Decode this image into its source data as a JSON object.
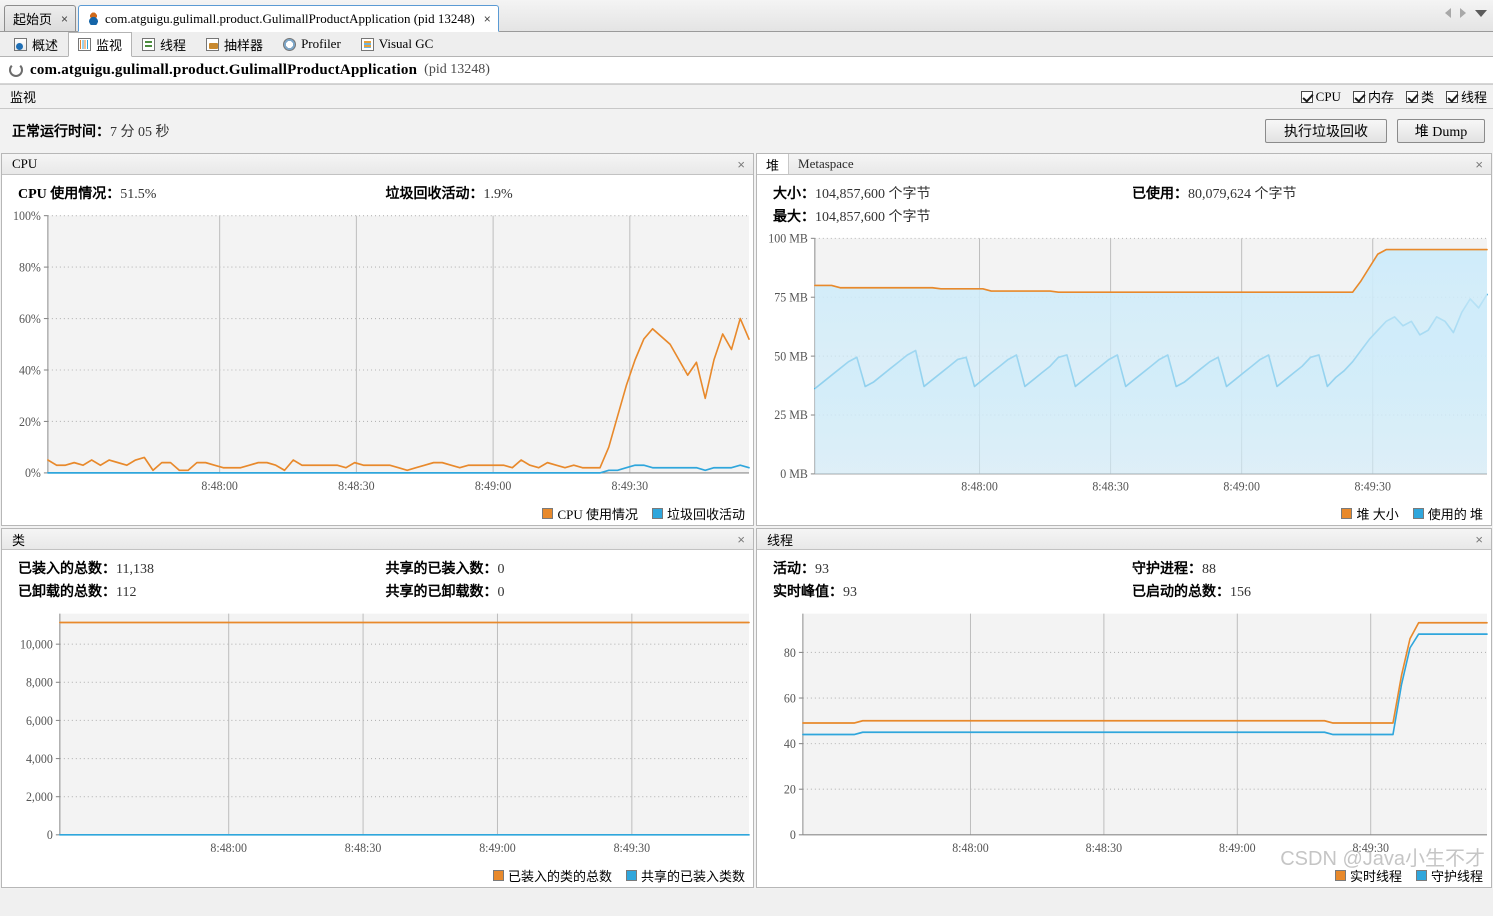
{
  "window": {
    "tabs": [
      {
        "label": "起始页",
        "icon": "none",
        "active": false,
        "closable": true
      },
      {
        "label": "com.atguigu.gulimall.product.GulimallProductApplication (pid 13248)",
        "icon": "java-icon",
        "active": true,
        "closable": true
      }
    ],
    "nav": {
      "prev": "left-arrow-icon",
      "next": "right-arrow-icon",
      "list": "chevron-down-icon"
    }
  },
  "subtabs": [
    {
      "label": "概述",
      "icon": "overview-icon",
      "active": false
    },
    {
      "label": "监视",
      "icon": "monitor-icon",
      "active": true
    },
    {
      "label": "线程",
      "icon": "threads-icon",
      "active": false
    },
    {
      "label": "抽样器",
      "icon": "sampler-icon",
      "active": false
    },
    {
      "label": "Profiler",
      "icon": "profiler-icon",
      "active": false
    },
    {
      "label": "Visual GC",
      "icon": "visualgc-icon",
      "active": false
    }
  ],
  "app_header": {
    "name": "com.atguigu.gulimall.product.GulimallProductApplication",
    "pid": "(pid 13248)"
  },
  "monitor_bar": {
    "title": "监视",
    "checkboxes": [
      {
        "label": "CPU",
        "checked": true
      },
      {
        "label": "内存",
        "checked": true
      },
      {
        "label": "类",
        "checked": true
      },
      {
        "label": "线程",
        "checked": true
      }
    ]
  },
  "uptime": {
    "label": "正常运行时间：",
    "value": "7 分 05 秒"
  },
  "actions": {
    "gc_label": "执行垃圾回收",
    "heapdump_label": "堆 Dump"
  },
  "panels": {
    "cpu": {
      "tab_title": "CPU",
      "close": "×",
      "stats": [
        {
          "label": "CPU 使用情况：",
          "value": "51.5%"
        },
        {
          "label": "垃圾回收活动：",
          "value": "1.9%"
        }
      ],
      "legend": [
        {
          "label": "CPU 使用情况",
          "color": "#e8892b"
        },
        {
          "label": "垃圾回收活动",
          "color": "#2fa6dc"
        }
      ]
    },
    "heap": {
      "tab_title": "堆",
      "tab_secondary": "Metaspace",
      "close": "×",
      "stats": [
        {
          "label": "大小：",
          "value": "104,857,600 个字节"
        },
        {
          "label": "已使用：",
          "value": "80,079,624 个字节"
        },
        {
          "label": "最大：",
          "value": "104,857,600 个字节"
        }
      ],
      "legend": [
        {
          "label": "堆 大小",
          "color": "#e8892b"
        },
        {
          "label": "使用的 堆",
          "color": "#2fa6dc"
        }
      ]
    },
    "classes": {
      "tab_title": "类",
      "close": "×",
      "stats": [
        {
          "label": "已装入的总数：",
          "value": "11,138"
        },
        {
          "label": "共享的已装入数：",
          "value": "0"
        },
        {
          "label": "已卸载的总数：",
          "value": "112"
        },
        {
          "label": "共享的已卸载数：",
          "value": "0"
        }
      ],
      "legend": [
        {
          "label": "已装入的类的总数",
          "color": "#e8892b"
        },
        {
          "label": "共享的已装入类数",
          "color": "#2fa6dc"
        }
      ]
    },
    "threads": {
      "tab_title": "线程",
      "close": "×",
      "stats": [
        {
          "label": "活动：",
          "value": "93"
        },
        {
          "label": "守护进程：",
          "value": "88"
        },
        {
          "label": "实时峰值：",
          "value": "93"
        },
        {
          "label": "已启动的总数：",
          "value": "156"
        }
      ],
      "legend": [
        {
          "label": "实时线程",
          "color": "#e8892b"
        },
        {
          "label": "守护线程",
          "color": "#2fa6dc"
        }
      ]
    }
  },
  "watermark": "CSDN @Java小生不才",
  "colors": {
    "orange": "#e8892b",
    "blue": "#2fa6dc",
    "orange_fill": "#f6d2a4",
    "blue_fill": "#cfecfa",
    "plot_bg": "#f3f3f3",
    "grid": "#c9c9c9"
  },
  "chart_data": [
    {
      "type": "line",
      "id": "cpu-chart",
      "title": "CPU",
      "xlabel": "",
      "ylabel": "",
      "ylim": [
        0,
        100
      ],
      "yticks": [
        "0%",
        "20%",
        "40%",
        "60%",
        "80%",
        "100%"
      ],
      "xticks": [
        "8:48:00",
        "8:48:30",
        "8:49:00",
        "8:49:30"
      ],
      "xtick_positions": [
        0.245,
        0.44,
        0.635,
        0.83
      ],
      "grid": true,
      "legend_position": "bottom-right",
      "series": [
        {
          "name": "CPU 使用情况",
          "color": "#e8892b",
          "values": [
            5,
            3,
            3,
            4,
            3,
            5,
            3,
            5,
            4,
            3,
            5,
            6,
            1,
            4,
            4,
            1,
            1,
            4,
            4,
            3,
            2,
            2,
            2,
            3,
            4,
            4,
            3,
            1,
            5,
            3,
            3,
            3,
            3,
            3,
            2,
            4,
            3,
            3,
            3,
            3,
            2,
            1,
            2,
            3,
            4,
            4,
            3,
            2,
            3,
            3,
            3,
            3,
            3,
            2,
            5,
            3,
            2,
            4,
            3,
            2,
            3,
            2,
            2,
            2,
            10,
            22,
            34,
            44,
            52,
            56,
            53,
            50,
            44,
            38,
            43,
            29,
            44,
            54,
            48,
            60,
            52
          ]
        },
        {
          "name": "垃圾回收活动",
          "color": "#2fa6dc",
          "values": [
            0,
            0,
            0,
            0,
            0,
            0,
            0,
            0,
            0,
            0,
            0,
            0,
            0,
            0,
            0,
            0,
            0,
            0,
            0,
            0,
            0,
            0,
            0,
            0,
            0,
            0,
            0,
            0,
            0,
            0,
            0,
            0,
            0,
            0,
            0,
            0,
            0,
            0,
            0,
            0,
            0,
            0,
            0,
            0,
            0,
            0,
            0,
            0,
            0,
            0,
            0,
            0,
            0,
            0,
            0,
            0,
            0,
            0,
            0,
            0,
            0,
            0,
            0,
            0,
            1,
            1,
            2,
            3,
            3,
            2,
            2,
            2,
            2,
            2,
            2,
            1,
            2,
            2,
            2,
            3,
            2
          ]
        }
      ]
    },
    {
      "type": "area",
      "id": "heap-chart",
      "title": "堆",
      "xlabel": "",
      "ylabel": "",
      "ylim": [
        0,
        105
      ],
      "yticks": [
        "0 MB",
        "25 MB",
        "50 MB",
        "75 MB",
        "100 MB"
      ],
      "xticks": [
        "8:48:00",
        "8:48:30",
        "8:49:00",
        "8:49:30"
      ],
      "xtick_positions": [
        0.245,
        0.44,
        0.635,
        0.83
      ],
      "grid": true,
      "legend_position": "bottom-right",
      "series": [
        {
          "name": "堆 大小",
          "color": "#e8892b",
          "fill": "#f6d2a4",
          "values": [
            84,
            84,
            84,
            83,
            83,
            83,
            83,
            83,
            83,
            83,
            83,
            83,
            83,
            83,
            83,
            82.5,
            82.5,
            82.5,
            82.5,
            82.5,
            82.5,
            81.5,
            81.5,
            81.5,
            81.5,
            81.5,
            81.5,
            81.5,
            81.5,
            81,
            81,
            81,
            81,
            81,
            81,
            81,
            81,
            81,
            81,
            81,
            81,
            81,
            81,
            81,
            81,
            81,
            81,
            81,
            81,
            81,
            81,
            81,
            81,
            81,
            81,
            81,
            81,
            81,
            81,
            81,
            81,
            81,
            81,
            81,
            81,
            86,
            92,
            98,
            100,
            100,
            100,
            100,
            100,
            100,
            100,
            100,
            100,
            100,
            100,
            100,
            100
          ]
        },
        {
          "name": "使用的 堆",
          "color": "#2fa6dc",
          "fill": "#cfecfa",
          "values": [
            38,
            41,
            44,
            47,
            50,
            52,
            39,
            41,
            44,
            47,
            50,
            53,
            55,
            39,
            42,
            45,
            48,
            51,
            52,
            39,
            42,
            45,
            48,
            51,
            53,
            39,
            42,
            45,
            48,
            52,
            53,
            39,
            42,
            45,
            48,
            51,
            53,
            39,
            42,
            45,
            48,
            51,
            53,
            39,
            41,
            44,
            47,
            50,
            52,
            39,
            42,
            45,
            48,
            51,
            53,
            39,
            42,
            45,
            48,
            52,
            53,
            39,
            43,
            46,
            50,
            55,
            60,
            64,
            68,
            70,
            66,
            68,
            62,
            64,
            70,
            68,
            63,
            72,
            78,
            74,
            80
          ]
        }
      ]
    },
    {
      "type": "line",
      "id": "classes-chart",
      "title": "类",
      "xlabel": "",
      "ylabel": "",
      "ylim": [
        0,
        11600
      ],
      "yticks": [
        "0",
        "2,000",
        "4,000",
        "6,000",
        "8,000",
        "10,000"
      ],
      "xticks": [
        "8:48:00",
        "8:48:30",
        "8:49:00",
        "8:49:30"
      ],
      "xtick_positions": [
        0.245,
        0.44,
        0.635,
        0.83
      ],
      "grid": true,
      "legend_position": "bottom-right",
      "series": [
        {
          "name": "已装入的类的总数",
          "color": "#e8892b",
          "constant": 11138
        },
        {
          "name": "共享的已装入类数",
          "color": "#2fa6dc",
          "constant": 0
        }
      ]
    },
    {
      "type": "line",
      "id": "threads-chart",
      "title": "线程",
      "xlabel": "",
      "ylabel": "",
      "ylim": [
        0,
        97
      ],
      "yticks": [
        "0",
        "20",
        "40",
        "60",
        "80"
      ],
      "xticks": [
        "8:48:00",
        "8:48:30",
        "8:49:00",
        "8:49:30"
      ],
      "xtick_positions": [
        0.245,
        0.44,
        0.635,
        0.83
      ],
      "grid": true,
      "legend_position": "bottom-right",
      "series": [
        {
          "name": "实时线程",
          "color": "#e8892b",
          "values": [
            49,
            49,
            49,
            49,
            49,
            49,
            49,
            50,
            50,
            50,
            50,
            50,
            50,
            50,
            50,
            50,
            50,
            50,
            50,
            50,
            50,
            50,
            50,
            50,
            50,
            50,
            50,
            50,
            50,
            50,
            50,
            50,
            50,
            50,
            50,
            50,
            50,
            50,
            50,
            50,
            50,
            50,
            50,
            50,
            50,
            50,
            50,
            50,
            50,
            50,
            50,
            50,
            50,
            50,
            50,
            50,
            50,
            50,
            50,
            50,
            50,
            50,
            49,
            49,
            49,
            49,
            49,
            49,
            49,
            49,
            70,
            86,
            93,
            93,
            93,
            93,
            93,
            93,
            93,
            93,
            93
          ]
        },
        {
          "name": "守护线程",
          "color": "#2fa6dc",
          "values": [
            44,
            44,
            44,
            44,
            44,
            44,
            44,
            45,
            45,
            45,
            45,
            45,
            45,
            45,
            45,
            45,
            45,
            45,
            45,
            45,
            45,
            45,
            45,
            45,
            45,
            45,
            45,
            45,
            45,
            45,
            45,
            45,
            45,
            45,
            45,
            45,
            45,
            45,
            45,
            45,
            45,
            45,
            45,
            45,
            45,
            45,
            45,
            45,
            45,
            45,
            45,
            45,
            45,
            45,
            45,
            45,
            45,
            45,
            45,
            45,
            45,
            45,
            44,
            44,
            44,
            44,
            44,
            44,
            44,
            44,
            66,
            82,
            88,
            88,
            88,
            88,
            88,
            88,
            88,
            88,
            88
          ]
        }
      ]
    }
  ]
}
